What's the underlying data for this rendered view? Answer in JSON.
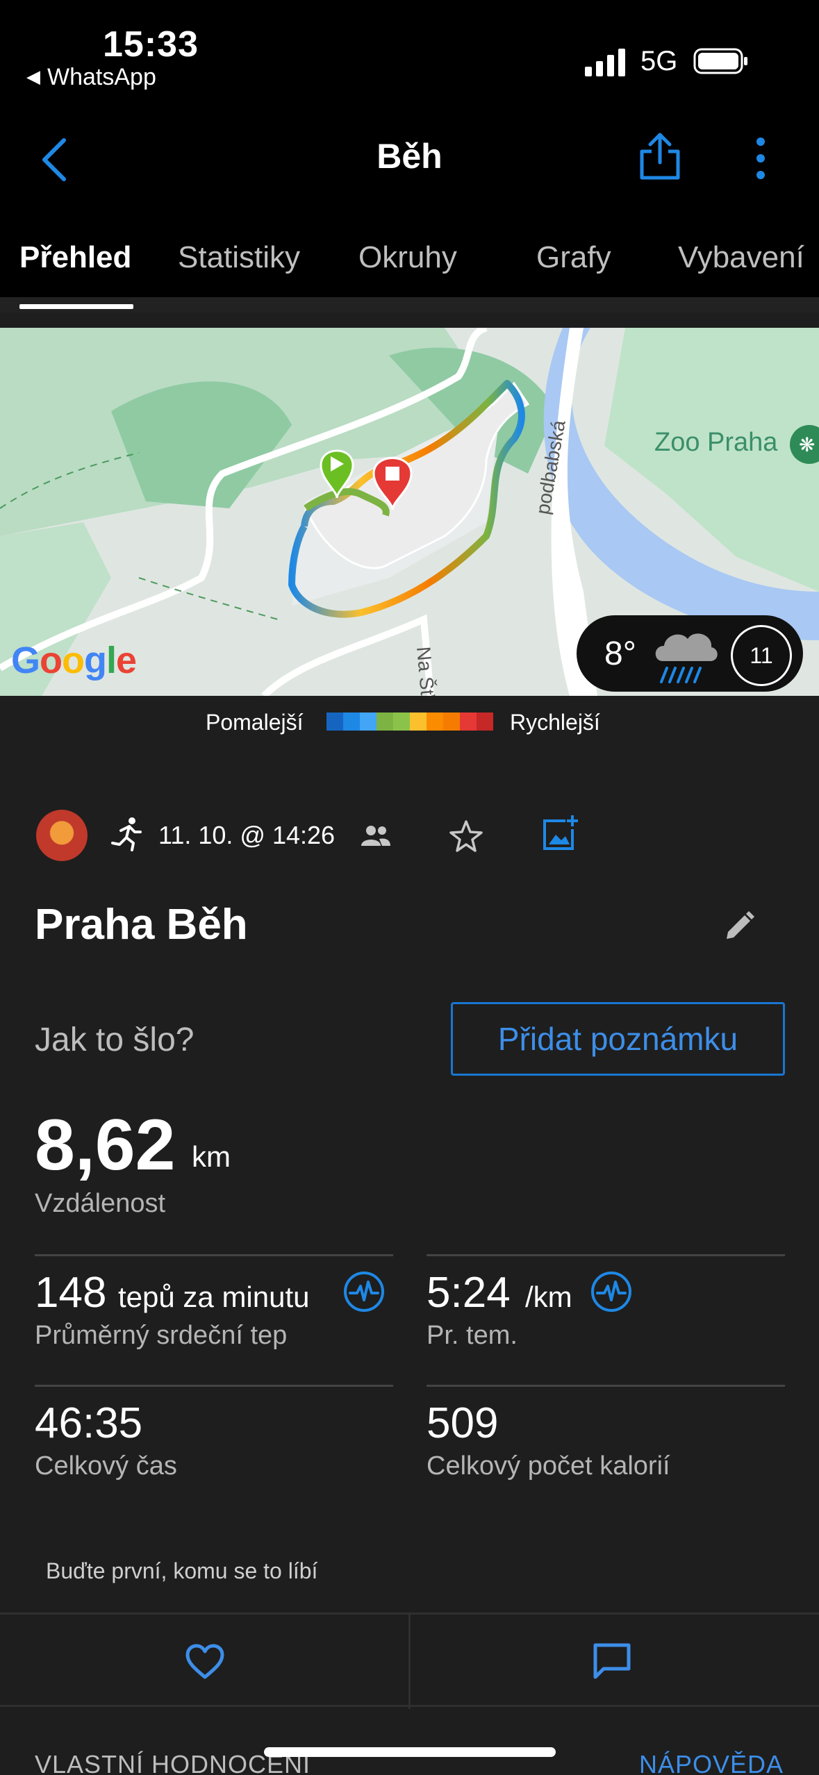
{
  "status_bar": {
    "time": "15:33",
    "back_app": "WhatsApp",
    "network": "5G",
    "signal_icon": "signal-bars-icon",
    "battery_icon": "battery-icon"
  },
  "nav": {
    "title": "Běh",
    "back_icon": "chevron-left-icon",
    "share_icon": "share-icon",
    "more_icon": "more-vertical-icon"
  },
  "tabs": [
    {
      "label": "Přehled",
      "active": true
    },
    {
      "label": "Statistiky",
      "active": false
    },
    {
      "label": "Okruhy",
      "active": false
    },
    {
      "label": "Grafy",
      "active": false
    },
    {
      "label": "Vybavení",
      "active": false
    }
  ],
  "map": {
    "provider_logo": "Google",
    "place_label": "Zoo Praha",
    "street_labels": [
      "podbabská",
      "Na Šťá"
    ],
    "weather": {
      "temperature": "8°",
      "condition_icon": "rain-cloud-icon",
      "moon_day": "11"
    }
  },
  "pace_legend": {
    "slow_label": "Pomalejší",
    "fast_label": "Rychlejší",
    "colors": [
      "#1565c0",
      "#1e88e5",
      "#42a5f5",
      "#7cb342",
      "#8bc34a",
      "#fbc02d",
      "#fb8c00",
      "#f57c00",
      "#e53935",
      "#c62828"
    ]
  },
  "activity": {
    "datetime": "11. 10. @ 14:26",
    "title": "Praha Běh",
    "how_it_went": "Jak to šlo?",
    "add_note_label": "Přidat poznámku"
  },
  "stats": {
    "distance": {
      "value": "8,62",
      "unit": "km",
      "label": "Vzdálenost"
    },
    "heart_rate": {
      "value": "148",
      "unit": "tepů za minutu",
      "label": "Průměrný srdeční tep"
    },
    "pace": {
      "value": "5:24",
      "unit": "/km",
      "label": "Pr. tem."
    },
    "total_time": {
      "value": "46:35",
      "label": "Celkový čas"
    },
    "calories": {
      "value": "509",
      "label": "Celkový počet kalorií"
    }
  },
  "social": {
    "likes_text": "Buďte první, komu se to líbí"
  },
  "footer": {
    "section_title": "VLASTNÍ HODNOCENÍ",
    "help_link": "NÁPOVĚDA"
  },
  "colors": {
    "accent": "#1e88e5",
    "background": "#1e1e1e",
    "header": "#000000"
  }
}
